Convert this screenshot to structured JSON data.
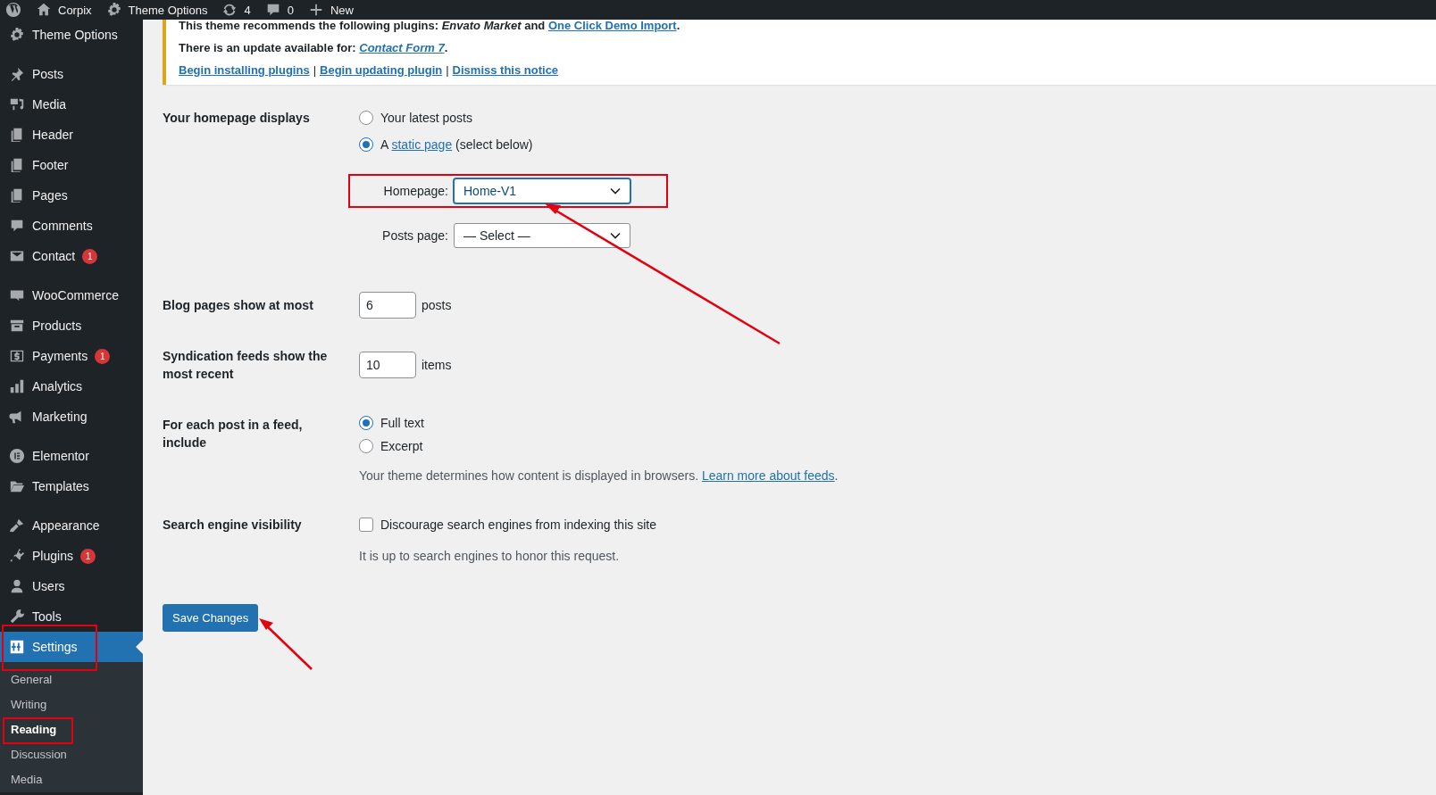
{
  "admin_bar": [
    {
      "kind": "wordpress"
    },
    {
      "kind": "home",
      "label": "Corpix"
    },
    {
      "kind": "gear",
      "label": "Theme Options"
    },
    {
      "kind": "updates",
      "label": "4"
    },
    {
      "kind": "comments",
      "label": "0"
    },
    {
      "kind": "plus",
      "label": "New"
    }
  ],
  "sidebar": {
    "groups": [
      [
        {
          "kind": "gear",
          "label": "Theme Options",
          "selected": false,
          "marked": false
        }
      ],
      [
        {
          "kind": "pin",
          "label": "Posts",
          "selected": false,
          "marked": false
        },
        {
          "kind": "media",
          "label": "Media",
          "selected": false,
          "marked": false
        },
        {
          "kind": "pages",
          "label": "Header",
          "selected": false,
          "marked": false
        },
        {
          "kind": "pages",
          "label": "Footer",
          "selected": false,
          "marked": false
        },
        {
          "kind": "pages",
          "label": "Pages",
          "selected": false,
          "marked": false
        },
        {
          "kind": "comments",
          "label": "Comments",
          "selected": false,
          "marked": false
        },
        {
          "kind": "envelope",
          "label": "Contact",
          "badge": "1",
          "selected": false,
          "marked": false
        }
      ],
      [
        {
          "kind": "woo",
          "label": "WooCommerce",
          "selected": false,
          "marked": false
        },
        {
          "kind": "archive",
          "label": "Products",
          "selected": false,
          "marked": false
        },
        {
          "kind": "dollar",
          "label": "Payments",
          "badge": "1",
          "selected": false,
          "marked": false
        },
        {
          "kind": "bars",
          "label": "Analytics",
          "selected": false,
          "marked": false
        },
        {
          "kind": "megaphone",
          "label": "Marketing",
          "selected": false,
          "marked": false
        }
      ],
      [
        {
          "kind": "elementor",
          "label": "Elementor",
          "selected": false,
          "marked": false
        },
        {
          "kind": "folder",
          "label": "Templates",
          "selected": false,
          "marked": false
        }
      ],
      [
        {
          "kind": "brush",
          "label": "Appearance",
          "selected": false,
          "marked": false
        },
        {
          "kind": "plug",
          "label": "Plugins",
          "badge": "1",
          "selected": false,
          "marked": false
        },
        {
          "kind": "user",
          "label": "Users",
          "selected": false,
          "marked": false
        },
        {
          "kind": "wrench",
          "label": "Tools",
          "selected": false,
          "marked": false
        },
        {
          "kind": "sliders",
          "label": "Settings",
          "selected": true,
          "marked": true
        }
      ]
    ],
    "submenu": [
      {
        "label": "General",
        "selected": false,
        "marked": false
      },
      {
        "label": "Writing",
        "selected": false,
        "marked": false
      },
      {
        "label": "Reading",
        "selected": true,
        "marked": true
      },
      {
        "label": "Discussion",
        "selected": false,
        "marked": false
      },
      {
        "label": "Media",
        "selected": false,
        "marked": false
      }
    ]
  },
  "notice": {
    "recommend": {
      "prefix": "This theme recommends the following plugins: ",
      "plugin": "Envato Market",
      "joiner": " and ",
      "link": "One Click Demo Import",
      "suffix": "."
    },
    "update": {
      "prefix": "There is an update available for: ",
      "link": "Contact Form 7",
      "suffix": "."
    },
    "actions": [
      "Begin installing plugins",
      "Begin updating plugin",
      "Dismiss this notice"
    ],
    "separator": "|"
  },
  "form": {
    "homepage_displays": {
      "label": "Your homepage displays",
      "options": [
        {
          "kind": "plain",
          "text": "Your latest posts",
          "selected": false
        },
        {
          "kind": "link",
          "before": "A ",
          "link": "static page",
          "after": " (select below)",
          "selected": true
        }
      ],
      "selects": [
        {
          "label": "Homepage:",
          "value": "Home-V1",
          "focused": true,
          "marked": true
        },
        {
          "label": "Posts page:",
          "value": "— Select —",
          "focused": false,
          "marked": false
        }
      ]
    },
    "blog_pages": {
      "label": "Blog pages show at most",
      "value": "6",
      "unit": "posts"
    },
    "syndication": {
      "label": "Syndication feeds show the most recent",
      "value": "10",
      "unit": "items"
    },
    "feed_include": {
      "label": "For each post in a feed, include",
      "options": [
        {
          "text": "Full text",
          "selected": true
        },
        {
          "text": "Excerpt",
          "selected": false
        }
      ],
      "description": "Your theme determines how content is displayed in browsers. ",
      "link": "Learn more about feeds",
      "suffix": "."
    },
    "search_visibility": {
      "label": "Search engine visibility",
      "checkbox": {
        "text": "Discourage search engines from indexing this site",
        "checked": false
      },
      "note": "It is up to search engines to honor this request."
    },
    "save_button": "Save Changes"
  }
}
